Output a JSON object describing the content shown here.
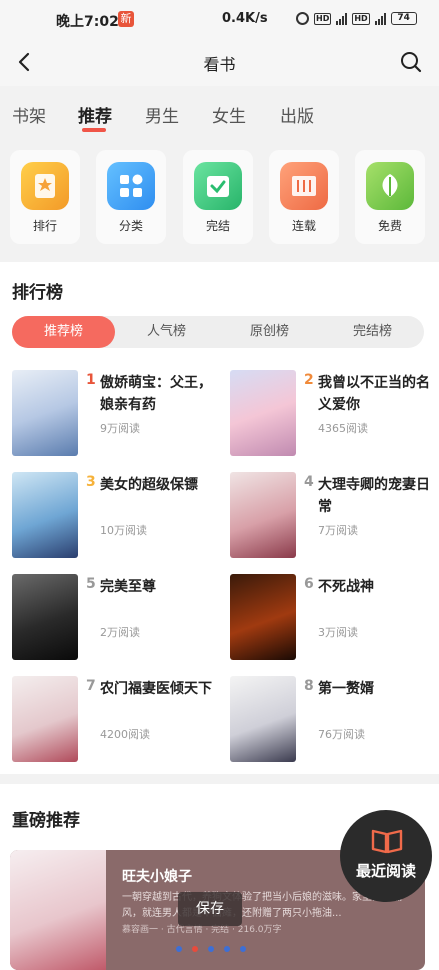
{
  "status_bar": {
    "time": "晚上7:02",
    "notification_icon": "新",
    "speed": "0.4K/s",
    "battery": "74"
  },
  "nav": {
    "title": "看书",
    "back_icon": "chevron-left-icon",
    "search_icon": "search-icon"
  },
  "tabs": [
    {
      "label": "书架",
      "active": false
    },
    {
      "label": "推荐",
      "active": true
    },
    {
      "label": "男生",
      "active": false
    },
    {
      "label": "女生",
      "active": false
    },
    {
      "label": "出版",
      "active": false
    }
  ],
  "categories": [
    {
      "label": "排行",
      "icon": "ranking-icon",
      "color": "#f6b23a"
    },
    {
      "label": "分类",
      "icon": "grid-icon",
      "color": "#4aa6f5"
    },
    {
      "label": "完结",
      "icon": "check-icon",
      "color": "#3fcf7f"
    },
    {
      "label": "连载",
      "icon": "book-open-icon",
      "color": "#f08058"
    },
    {
      "label": "免费",
      "icon": "leaf-icon",
      "color": "#7fcb4a"
    }
  ],
  "ranking": {
    "title": "排行榜",
    "segments": [
      {
        "label": "推荐榜",
        "active": true
      },
      {
        "label": "人气榜",
        "active": false
      },
      {
        "label": "原创榜",
        "active": false
      },
      {
        "label": "完结榜",
        "active": false
      }
    ],
    "books": [
      {
        "rank": "1",
        "name": "傲娇萌宝：父王，娘亲有药",
        "reads": "9万阅读",
        "rank_color": "#e8553a"
      },
      {
        "rank": "2",
        "name": "我曾以不正当的名义爱你",
        "reads": "4365阅读",
        "rank_color": "#f08a3a"
      },
      {
        "rank": "3",
        "name": "美女的超级保镖",
        "reads": "10万阅读",
        "rank_color": "#f6b23a"
      },
      {
        "rank": "4",
        "name": "大理寺卿的宠妻日常",
        "reads": "7万阅读",
        "rank_color": "#999999"
      },
      {
        "rank": "5",
        "name": "完美至尊",
        "reads": "2万阅读",
        "rank_color": "#999999"
      },
      {
        "rank": "6",
        "name": "不死战神",
        "reads": "3万阅读",
        "rank_color": "#999999"
      },
      {
        "rank": "7",
        "name": "农门福妻医倾天下",
        "reads": "4200阅读",
        "rank_color": "#999999"
      },
      {
        "rank": "8",
        "name": "第一赘婿",
        "reads": "76万阅读",
        "rank_color": "#999999"
      }
    ]
  },
  "featured": {
    "title": "重磅推荐",
    "book_title": "旺夫小娘子",
    "desc": "一朝穿越到古代，养狗文体验了把当小后娘的滋味。家里穷的漏风，就连男人都是个面瘫，还附赠了两只小拖油...",
    "meta": "慕容画一 · 古代言情 · 完结 · 216.0万字",
    "save_label": "保存"
  },
  "recent": {
    "label": "最近阅读",
    "icon": "book-icon"
  }
}
